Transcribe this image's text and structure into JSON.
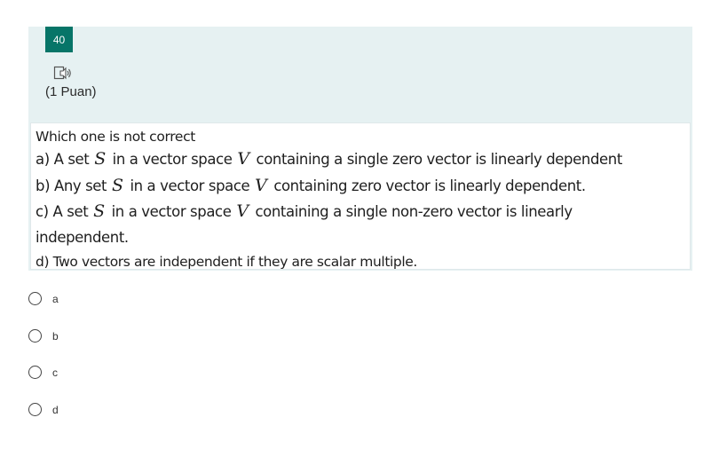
{
  "question": {
    "number": "40",
    "points": "(1 Puan)",
    "prompt": "Which one is not correct",
    "lines": [
      {
        "pre": "a) A set ",
        "var1": "S",
        "mid": " in a vector space ",
        "var2": "V",
        "post": " containing a single zero vector is linearly dependent"
      },
      {
        "pre": "b) Any set ",
        "var1": "S",
        "mid": " in a vector space ",
        "var2": "V",
        "post": " containing zero vector is linearly dependent."
      },
      {
        "pre": "c) A set ",
        "var1": "S",
        "mid": " in a vector space ",
        "var2": "V",
        "post": " containing a single non-zero vector is linearly"
      },
      {
        "text": "independent."
      },
      {
        "text": "d) Two vectors are independent if they are scalar multiple."
      }
    ]
  },
  "options": [
    {
      "label": "a"
    },
    {
      "label": "b"
    },
    {
      "label": "c"
    },
    {
      "label": "d"
    }
  ],
  "icons": {
    "immersive_reader": "speaker-icon"
  },
  "colors": {
    "badge": "#077568",
    "card_background": "#e6f1f2"
  }
}
